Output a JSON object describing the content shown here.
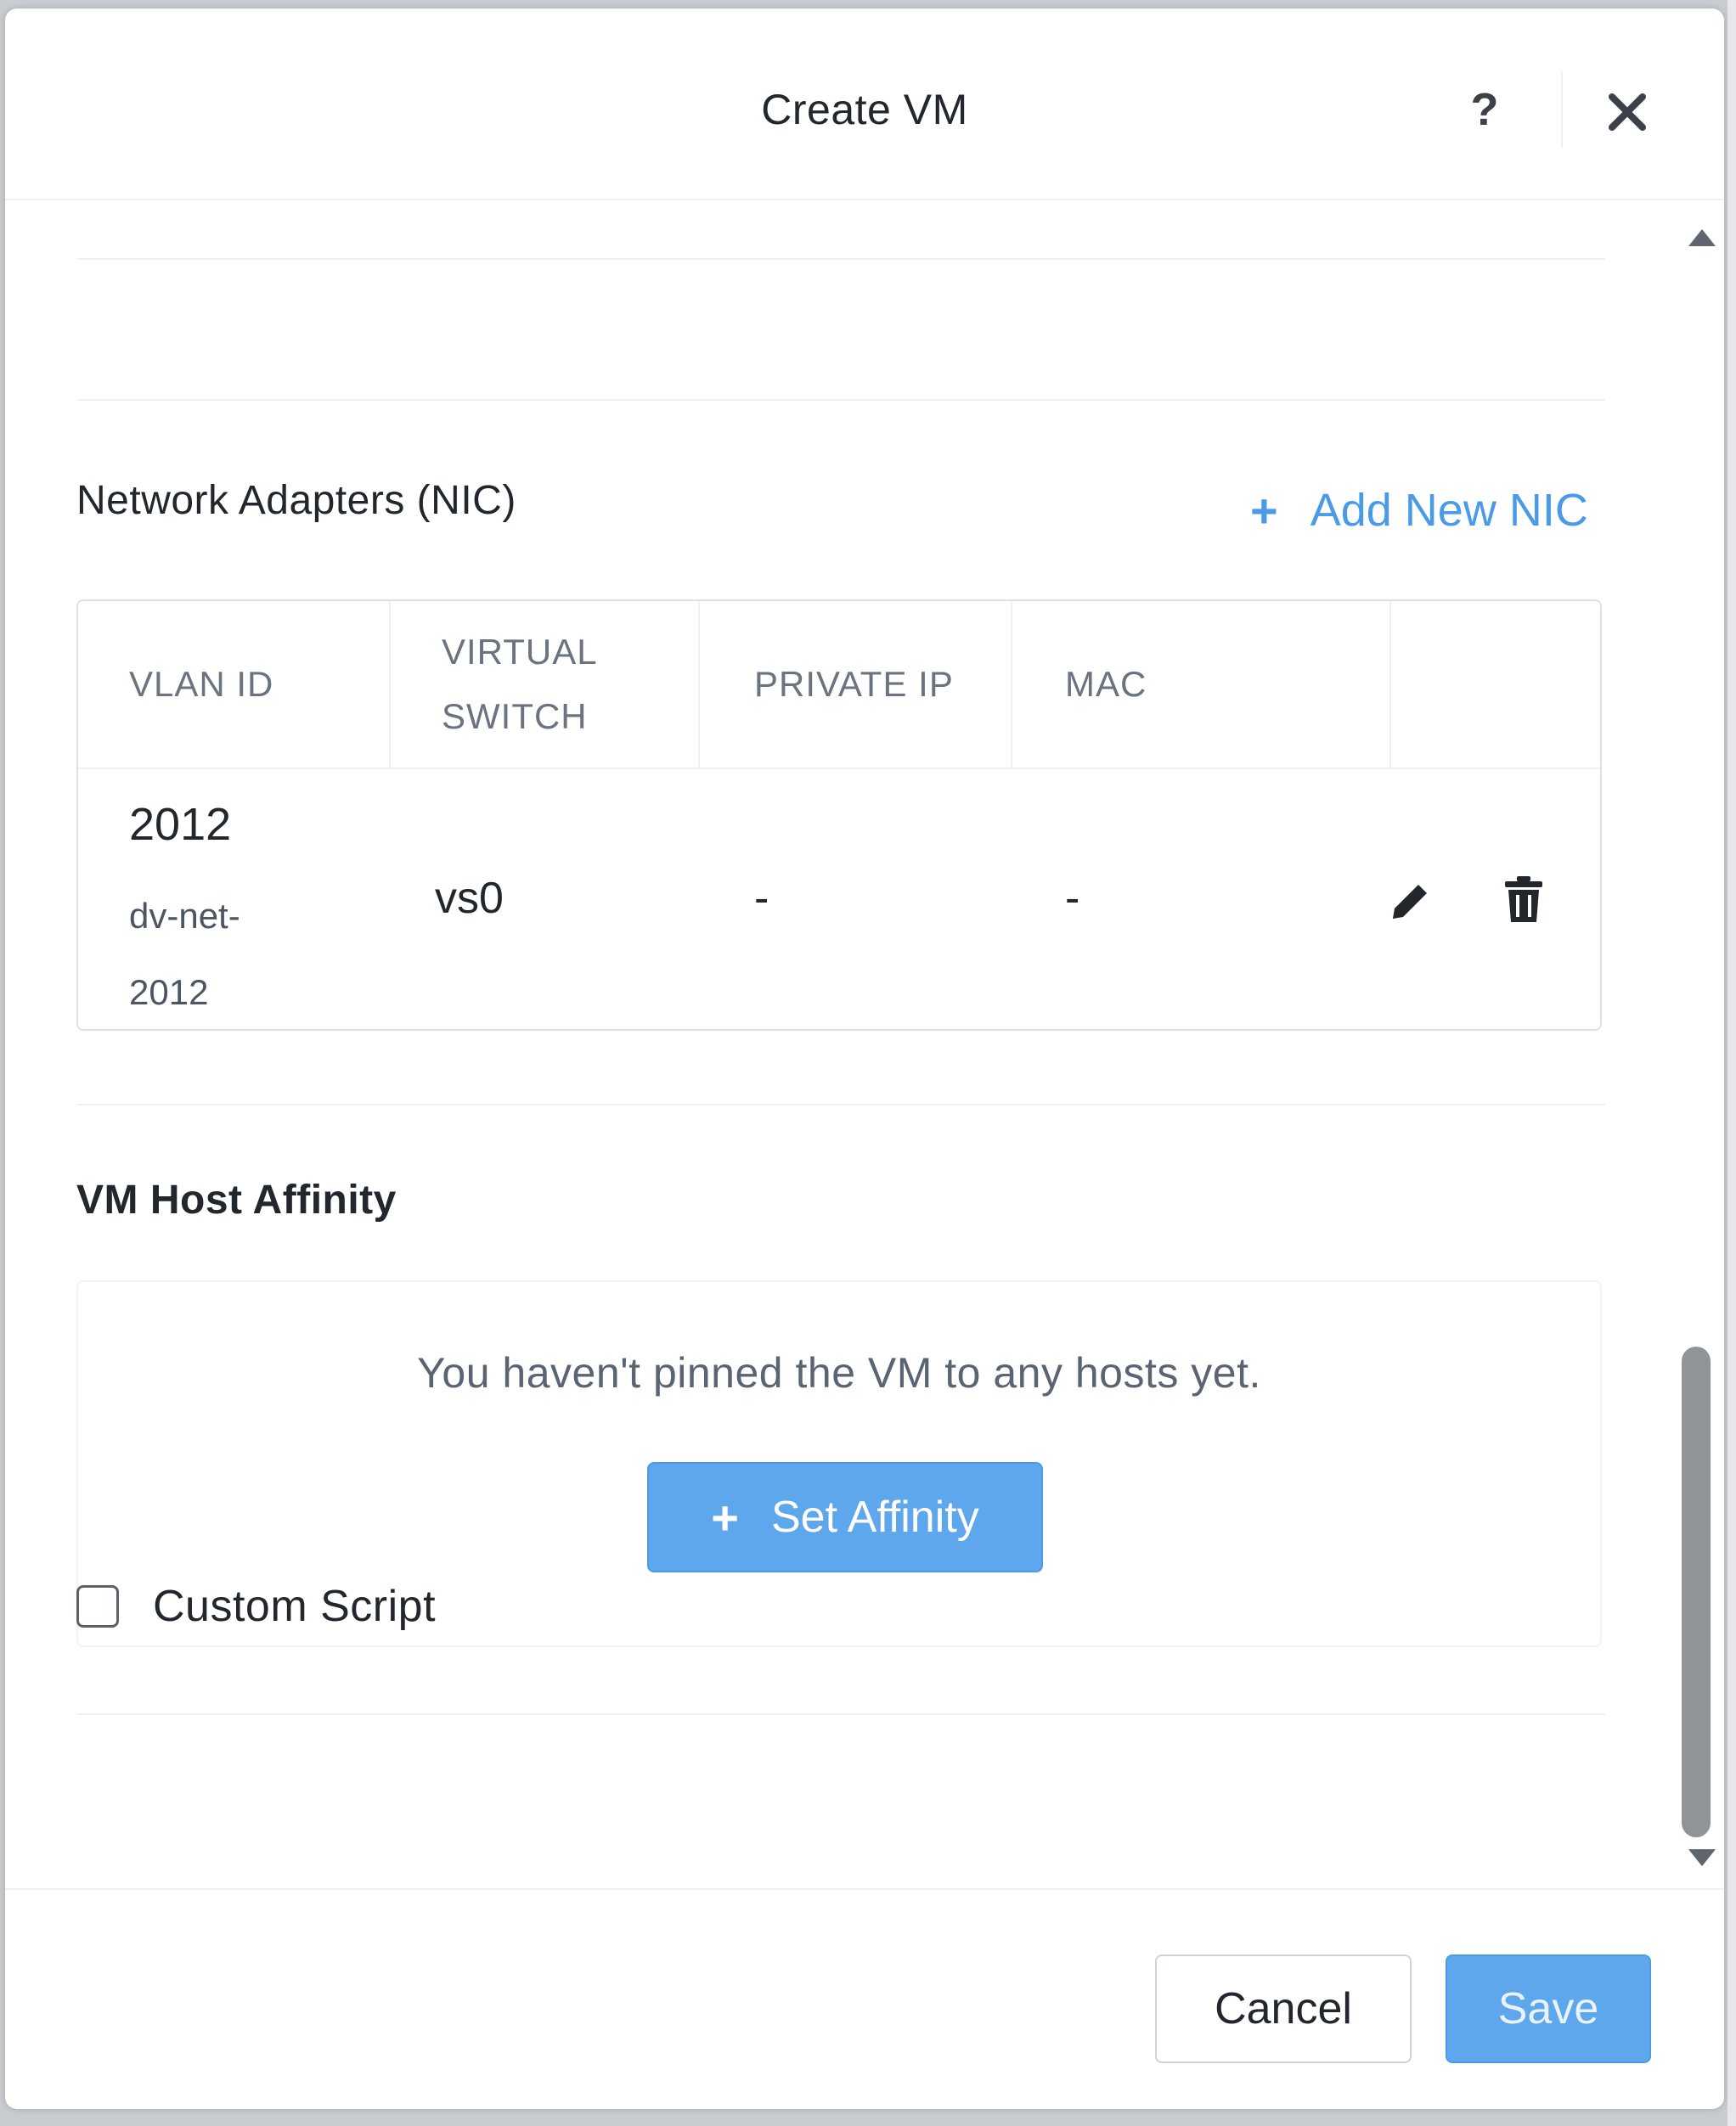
{
  "modal": {
    "title": "Create VM",
    "help_icon": "question-mark-icon",
    "close_icon": "close-icon"
  },
  "nic_section": {
    "title": "Network Adapters (NIC)",
    "add_button_label": "Add New NIC",
    "add_icon": "plus-icon",
    "columns": [
      "VLAN ID",
      "VIRTUAL SWITCH",
      "PRIVATE IP",
      "MAC"
    ],
    "rows": [
      {
        "vlan_id": "2012",
        "vlan_name": "dv-net-2012",
        "virtual_switch": "vs0",
        "private_ip": "-",
        "mac": "-",
        "actions": [
          "pencil-icon",
          "trash-icon"
        ]
      }
    ]
  },
  "affinity_section": {
    "title": "VM Host Affinity",
    "empty_message": "You haven't pinned the VM to any hosts yet.",
    "set_button_label": "Set Affinity",
    "set_icon": "plus-icon"
  },
  "custom_script": {
    "label": "Custom Script",
    "checked": false
  },
  "footer": {
    "cancel_label": "Cancel",
    "save_label": "Save"
  },
  "colors": {
    "accent": "#4a9ae8",
    "primary_button": "#5ea7ec",
    "text": "#22272e",
    "muted_text": "#6b7280",
    "border": "#dde0e4"
  }
}
